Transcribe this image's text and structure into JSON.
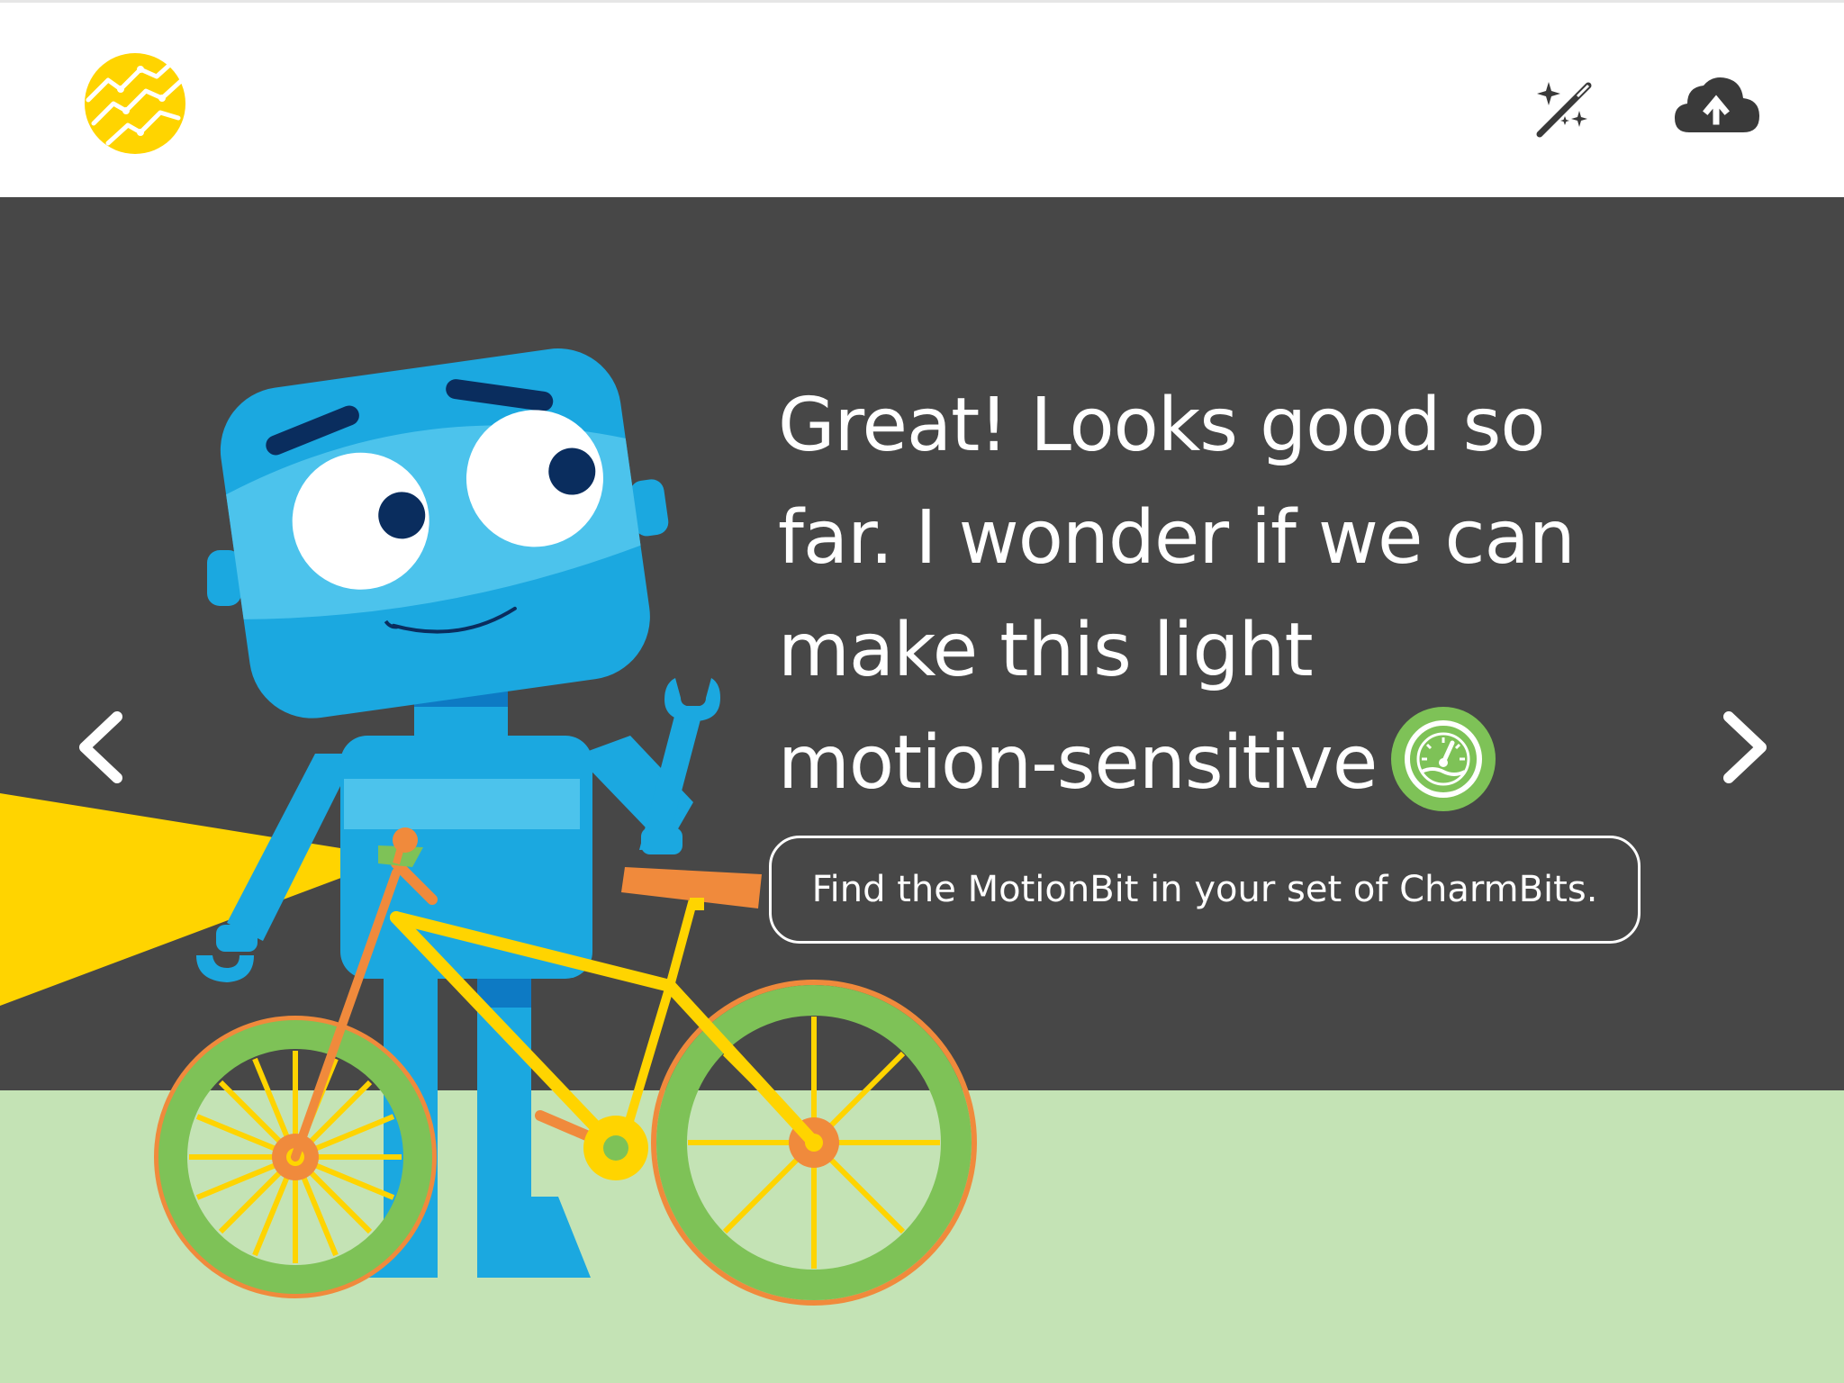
{
  "app": {
    "logo_icon": "charmbits-logo-icon",
    "toolbar": {
      "magic_icon": "magic-wand-icon",
      "upload_icon": "cloud-upload-icon"
    }
  },
  "lesson": {
    "message_lines": [
      "Great! Looks good so",
      "far. I wonder if we can",
      "make this light",
      "motion-sensitive"
    ],
    "sensor_icon": "motionbit-gauge-icon",
    "hint": "Find the MotionBit in your set of CharmBits."
  },
  "navigation": {
    "prev_icon": "chevron-left-icon",
    "next_icon": "chevron-right-icon"
  },
  "colors": {
    "stage": "#474747",
    "ground": "#c4e3b5",
    "robot_blue": "#1ba8e0",
    "robot_light": "#4cc3ec",
    "bike_yellow": "#ffd400",
    "tire_green": "#7ec257",
    "accent_orange": "#f08a3c",
    "sensor_green": "#7ec257"
  }
}
